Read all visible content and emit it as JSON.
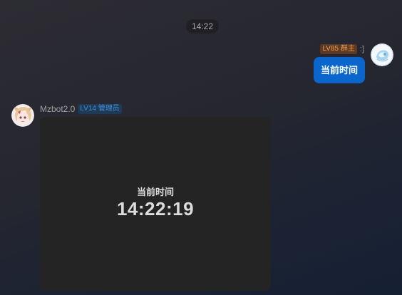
{
  "chat": {
    "timestamp": "14:22"
  },
  "user_message": {
    "level_badge": "LV85 群主",
    "name": ":]",
    "text": "当前时间",
    "avatar_icon": "user-avatar-icon",
    "bubble_color": "#0a66cc"
  },
  "bot_message": {
    "name": "Mzbot2.0",
    "level_badge": "LV14 管理员",
    "avatar_icon": "bot-avatar-icon",
    "card": {
      "title": "当前时间",
      "time": "14:22:19"
    }
  },
  "colors": {
    "owner_badge": "#f39a4e",
    "admin_badge": "#3f8fd8",
    "card_background": "#242424"
  }
}
